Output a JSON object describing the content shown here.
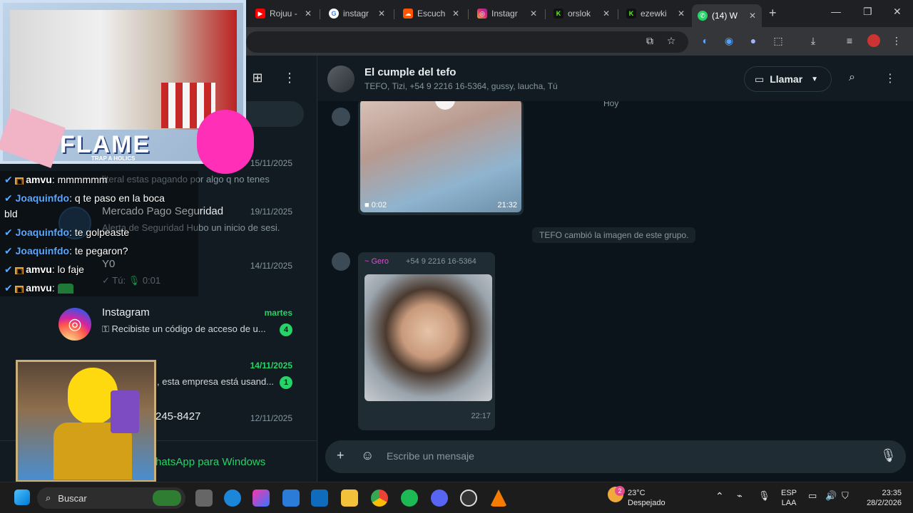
{
  "browser": {
    "tabs": [
      {
        "label": "Rojuu -",
        "icon": "youtube-icon"
      },
      {
        "label": "instagr",
        "icon": "google-icon"
      },
      {
        "label": "Escuch",
        "icon": "soundcloud-icon"
      },
      {
        "label": "Instagr",
        "icon": "instagram-icon"
      },
      {
        "label": "orslok",
        "icon": "kick-icon"
      },
      {
        "label": "ezewki",
        "icon": "kick-icon"
      },
      {
        "label": "(14) W",
        "icon": "whatsapp-icon"
      }
    ]
  },
  "sidebar": {
    "chats": [
      {
        "name": "",
        "time": "15/11/2025",
        "preview": "literal estas pagando por algo q no tenes"
      },
      {
        "name": "Mercado Pago Seguridad",
        "time": "19/11/2025",
        "preview": "Alerta de Seguridad Hubo un inicio de sesi..."
      },
      {
        "name": "Y0",
        "time": "14/11/2025",
        "preview": "Tú:",
        "duration": "0:01"
      },
      {
        "name": "Instagram",
        "time": "martes",
        "preview": "Recibiste un código de acceso de u...",
        "badge": "4"
      },
      {
        "name": "",
        "time": "14/11/2025",
        "preview": ", esta empresa está usand...",
        "badge": "1"
      },
      {
        "name": "245-8427",
        "time": "12/11/2025",
        "preview": ""
      }
    ],
    "footer": "hatsApp para Windows"
  },
  "chat": {
    "title": "El cumple del tefo",
    "members": "TEFO, Tizi, +54 9 2216 16-5364, gussy, laucha, Tú",
    "call_label": "Llamar",
    "date_hint": "Hoy",
    "video": {
      "duration": "0:02",
      "time": "21:32"
    },
    "system_msg": "TEFO cambió la imagen de este grupo.",
    "sender": {
      "name": "~ Gero",
      "phone": "+54 9 2216 16-5364"
    },
    "image_time": "22:17",
    "composer_placeholder": "Escribe un mensaje"
  },
  "overlay": {
    "stream_logo": "FLAME",
    "stream_logo_sub": "TRAP A HOLICS",
    "messages": [
      {
        "user": "amvu",
        "text": ": mmmmmm"
      },
      {
        "user": "Joaquinfdo",
        "text": ": q te paso en la boca"
      },
      {
        "user": "",
        "text": "bld"
      },
      {
        "user": "Joaquinfdo",
        "text": ": te golpeaste"
      },
      {
        "user": "Joaquinfdo",
        "text": ": te pegaron?"
      },
      {
        "user": "amvu",
        "text": ": lo faje"
      },
      {
        "user": "amvu",
        "text": ":"
      }
    ]
  },
  "taskbar": {
    "search": "Buscar",
    "weather_temp": "23°C",
    "weather_desc": "Despejado",
    "weather_badge": "2",
    "lang_top": "ESP",
    "lang_bottom": "LAA",
    "clock_time": "23:35",
    "clock_date": "28/2/2026"
  },
  "colors": {
    "wa_green": "#25d366",
    "panel": "#111b21",
    "chat_bg": "#0b141a",
    "accent_blue": "#5aa9ff"
  }
}
